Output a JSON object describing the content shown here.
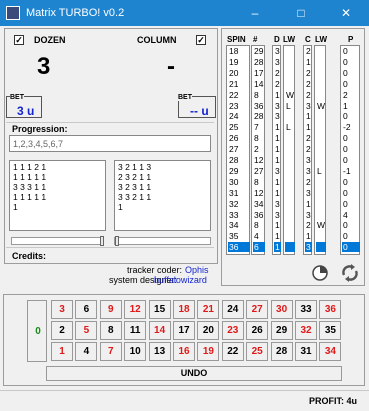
{
  "window": {
    "title": "Matrix TURBO! v0.2",
    "minimize": "–",
    "maximize": "□",
    "close": "✕"
  },
  "dozen": {
    "label": "DOZEN",
    "value": "3",
    "checked": "✓"
  },
  "column": {
    "label": "COLUMN",
    "value": "-",
    "checked": "✓"
  },
  "bet_left": {
    "label": "BET",
    "value": "3 u"
  },
  "bet_right": {
    "label": "BET",
    "value": "-- u"
  },
  "progression": {
    "label": "Progression:",
    "value": "1,2,3,4,5,6,7"
  },
  "matrix_left": [
    "1 1 1 2 1",
    "1 1 1 1 1",
    "3 3 3 1 1",
    "1 1 1 1 1",
    "1"
  ],
  "matrix_right": [
    "3 2 1 1 3",
    "2 3 2 1 1",
    "3 2 3 1 1",
    "3 3 2 1 1",
    "1"
  ],
  "credits": {
    "label": "Credits:",
    "coder_label": "tracker coder:",
    "coder": "Ophis",
    "designer_label": "system designer:",
    "designer": "buffalowizard"
  },
  "table_headers": {
    "spin": "SPIN",
    "hash": "#",
    "d": "D",
    "lw1": "LW",
    "c": "C",
    "lw2": "LW",
    "p": "P"
  },
  "spins": [
    "18",
    "19",
    "20",
    "21",
    "22",
    "23",
    "24",
    "25",
    "26",
    "27",
    "28",
    "29",
    "30",
    "31",
    "32",
    "33",
    "34",
    "35",
    "36"
  ],
  "hashes": [
    "29",
    "28",
    "17",
    "14",
    "8",
    "36",
    "28",
    "7",
    "8",
    "2",
    "12",
    "27",
    "8",
    "12",
    "34",
    "36",
    "8",
    "4",
    "6"
  ],
  "d_col": [
    "3",
    "3",
    "2",
    "2",
    "1",
    "3",
    "3",
    "1",
    "1",
    "1",
    "1",
    "3",
    "1",
    "1",
    "3",
    "3",
    "1",
    "1",
    "1"
  ],
  "lw1": [
    "",
    "",
    "",
    "",
    "W",
    "L",
    "",
    "L",
    "",
    "",
    "",
    "",
    "",
    "",
    "",
    "",
    "",
    "",
    ""
  ],
  "c_col": [
    "2",
    "1",
    "2",
    "2",
    "2",
    "3",
    "1",
    "1",
    "2",
    "2",
    "3",
    "3",
    "2",
    "3",
    "1",
    "3",
    "2",
    "1",
    "3"
  ],
  "lw2": [
    "",
    "",
    "",
    "",
    "",
    "W",
    "",
    "",
    "",
    "",
    "",
    "L",
    "",
    "",
    "",
    "",
    "W",
    "",
    ""
  ],
  "p_col": [
    "0",
    "0",
    "0",
    "0",
    "2",
    "1",
    "0",
    "-2",
    "0",
    "0",
    "0",
    "-1",
    "0",
    "0",
    "0",
    "4",
    "0",
    "0",
    "0"
  ],
  "icons": {
    "chart": "pie-chart-icon",
    "refresh": "recycle-icon"
  },
  "board": {
    "zero": "0",
    "top": [
      "3",
      "6",
      "9",
      "12",
      "15",
      "18",
      "21",
      "24",
      "27",
      "30",
      "33",
      "36"
    ],
    "mid": [
      "2",
      "5",
      "8",
      "11",
      "14",
      "17",
      "20",
      "23",
      "26",
      "29",
      "32",
      "35"
    ],
    "bot": [
      "1",
      "4",
      "7",
      "10",
      "13",
      "16",
      "19",
      "22",
      "25",
      "28",
      "31",
      "34"
    ],
    "undo": "UNDO"
  },
  "reds": [
    "1",
    "3",
    "5",
    "7",
    "9",
    "12",
    "14",
    "16",
    "18",
    "19",
    "21",
    "23",
    "25",
    "27",
    "30",
    "32",
    "34",
    "36"
  ],
  "status": {
    "profit": "PROFIT: 4u"
  }
}
